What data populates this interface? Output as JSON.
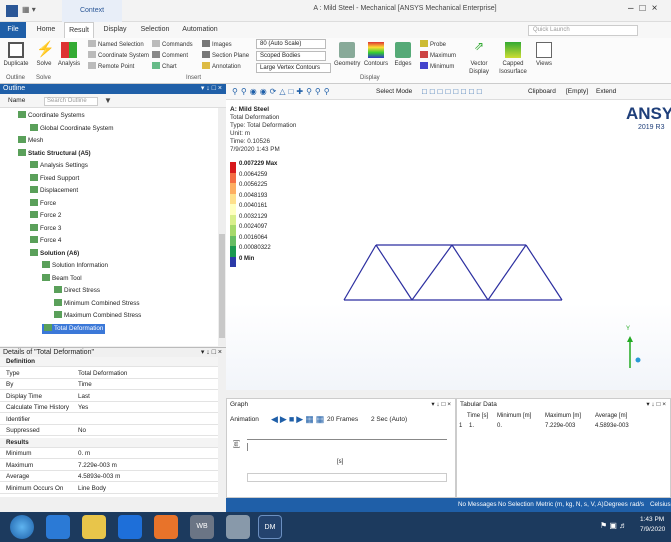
{
  "window": {
    "context_tab": "Context",
    "title": "A : Mild Steel - Mechanical [ANSYS Mechanical Enterprise]",
    "quick_launch": "Quick Launch"
  },
  "ribbon_tabs": [
    "File",
    "Home",
    "Result",
    "Display",
    "Selection",
    "Automation"
  ],
  "ribbon": {
    "duplicate": "Duplicate",
    "solve": "Solve",
    "analysis": "Analysis",
    "outline_grp": "Outline",
    "solve_grp": "Solve",
    "named_selection": "Named Selection",
    "coordinate_system": "Coordinate System",
    "remote_point": "Remote Point",
    "commands": "Commands",
    "comment": "Comment",
    "chart": "Chart",
    "images": "Images",
    "section_plane": "Section Plane",
    "annotation": "Annotation",
    "insert_grp": "Insert",
    "scale": "80 (Auto Scale)",
    "scoped": "Scoped Bodies",
    "contours": "Large Vertex Contours",
    "geometry": "Geometry",
    "contours_btn": "Contours",
    "edges": "Edges",
    "probe": "Probe",
    "maximum": "Maximum",
    "minimum": "Minimum",
    "vector_display": "Vector Display",
    "capped_isosurface": "Capped Isosurface",
    "views": "Views",
    "display_grp": "Display"
  },
  "outline": {
    "header": "Outline",
    "name_label": "Name",
    "search_placeholder": "Search Outline",
    "items": [
      {
        "label": "Coordinate Systems",
        "level": 1
      },
      {
        "label": "Global Coordinate System",
        "level": 2
      },
      {
        "label": "Mesh",
        "level": 1
      },
      {
        "label": "Static Structural (A5)",
        "level": 1
      },
      {
        "label": "Analysis Settings",
        "level": 2
      },
      {
        "label": "Fixed Support",
        "level": 2
      },
      {
        "label": "Displacement",
        "level": 2
      },
      {
        "label": "Force",
        "level": 2
      },
      {
        "label": "Force 2",
        "level": 2
      },
      {
        "label": "Force 3",
        "level": 2
      },
      {
        "label": "Force 4",
        "level": 2
      },
      {
        "label": "Solution (A6)",
        "level": 2
      },
      {
        "label": "Solution Information",
        "level": 3
      },
      {
        "label": "Beam Tool",
        "level": 3
      },
      {
        "label": "Direct Stress",
        "level": 4
      },
      {
        "label": "Minimum Combined Stress",
        "level": 4
      },
      {
        "label": "Maximum Combined Stress",
        "level": 4
      },
      {
        "label": "Total Deformation",
        "level": 3
      }
    ]
  },
  "details": {
    "header": "Details of \"Total Deformation\"",
    "rows": [
      {
        "k": "Definition",
        "v": "",
        "sec": true
      },
      {
        "k": "Type",
        "v": "Total Deformation"
      },
      {
        "k": "By",
        "v": "Time"
      },
      {
        "k": "Display Time",
        "v": "Last"
      },
      {
        "k": "Calculate Time History",
        "v": "Yes"
      },
      {
        "k": "Identifier",
        "v": ""
      },
      {
        "k": "Suppressed",
        "v": "No"
      },
      {
        "k": "Results",
        "v": "",
        "sec": true
      },
      {
        "k": "Minimum",
        "v": "0. m"
      },
      {
        "k": "Maximum",
        "v": "7.229e-003 m"
      },
      {
        "k": "Average",
        "v": "4.5893e-003 m"
      },
      {
        "k": "Minimum Occurs On",
        "v": "Line Body"
      }
    ]
  },
  "viewport": {
    "model": "A: Mild Steel",
    "result": "Total Deformation",
    "type": "Type: Total Deformation",
    "unit": "Unit: m",
    "time": "Time: 0.10526",
    "date": "7/9/2020 1:43 PM",
    "legend": [
      "0.007229 Max",
      "0.0064259",
      "0.0056225",
      "0.0048193",
      "0.0040161",
      "0.0032129",
      "0.0024097",
      "0.0016064",
      "0.00080322",
      "0 Min"
    ],
    "legend_colors": [
      "#d7191c",
      "#f46d43",
      "#fdae61",
      "#fee08b",
      "#ffffbf",
      "#d9ef8b",
      "#a6d96a",
      "#66bd63",
      "#1a9850",
      "#2b3aa8"
    ],
    "brand": "ANSYS",
    "version": "2019 R3",
    "axis_y": "Y",
    "truss_color": "#2c2fa0"
  },
  "toolbar": {
    "select": "Select",
    "mode": "Mode",
    "clipboard": "Clipboard",
    "empty": "[Empty]",
    "extend": "Extend"
  },
  "graph": {
    "header": "Graph",
    "animation": "Animation",
    "frames": "20 Frames",
    "duration": "2 Sec (Auto)",
    "y_axis": "[m]",
    "x_axis": "[s]"
  },
  "tabular": {
    "header": "Tabular Data",
    "cols": [
      "Time [s]",
      "Minimum [m]",
      "Maximum [m]",
      "Average [m]"
    ],
    "row": [
      "1",
      "1.",
      "0.",
      "7.229e-003",
      "4.5893e-003"
    ]
  },
  "status": {
    "messages": "No Messages",
    "selection": "No Selection",
    "units": "Metric (m, kg, N, s, V, A)",
    "degrees": "Degrees",
    "rads": "rad/s",
    "celsius": "Celsius"
  },
  "taskbar": {
    "app_dm": "DM",
    "app_wb": "WB",
    "time": "1:43 PM",
    "date": "7/9/2020"
  }
}
